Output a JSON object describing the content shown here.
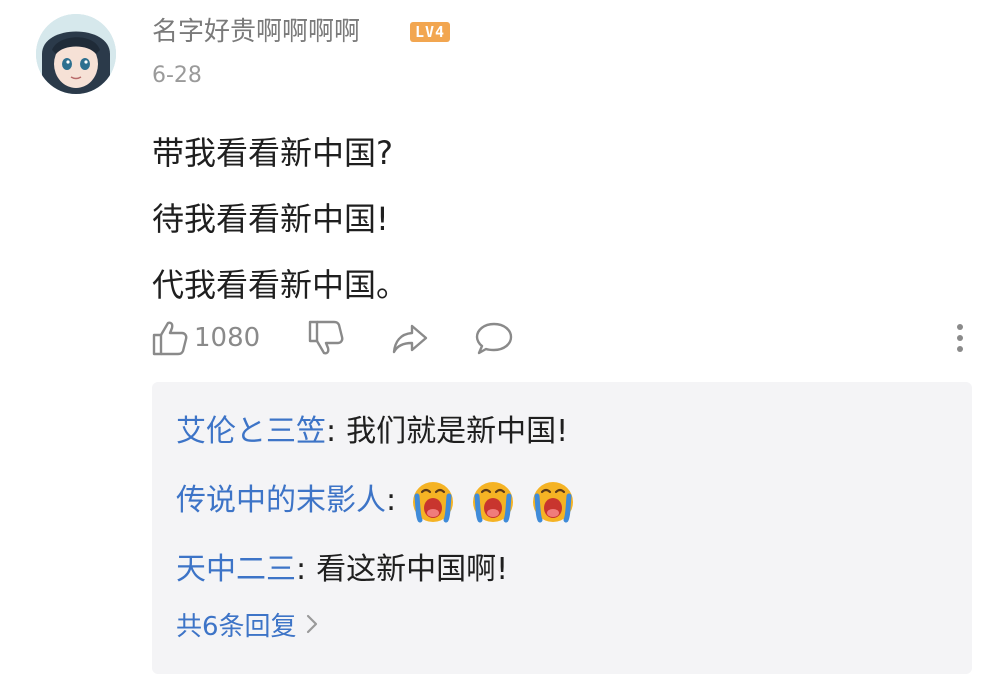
{
  "comment": {
    "username": "名字好贵啊啊啊啊",
    "level_badge": "LV4",
    "date": "6-28",
    "lines": [
      "带我看看新中国?",
      "待我看看新中国!",
      "代我看看新中国。"
    ],
    "actions": {
      "like_count": "1080",
      "icons": [
        "thumbs-up-icon",
        "thumbs-down-icon",
        "share-icon",
        "comment-icon",
        "more-vertical-icon"
      ]
    }
  },
  "replies": {
    "items": [
      {
        "author": "艾伦と三笠",
        "colon": ":",
        "text": "我们就是新中国!"
      },
      {
        "author": "传说中的末影人",
        "colon": ":",
        "emoji": [
          "crying-emoji",
          "crying-emoji",
          "crying-emoji"
        ]
      },
      {
        "author": "天中二三",
        "colon": ":",
        "text": "看这新中国啊!"
      }
    ],
    "more_label": "共6条回复"
  },
  "colors": {
    "link_blue": "#3d74c7",
    "badge_orange": "#f2a650",
    "reply_bg": "#f4f4f6",
    "muted_text": "#8a8a8a"
  }
}
